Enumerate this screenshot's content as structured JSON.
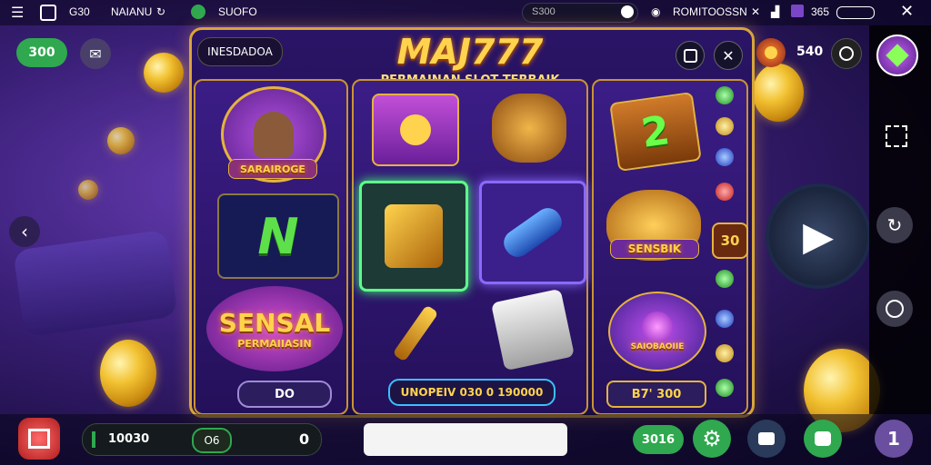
{
  "status_bar": {
    "left_code": "G30",
    "network_name": "NAIANU",
    "app_label": "SUOFO",
    "search_placeholder": "S300",
    "right_label": "ROMITOOSSN",
    "battery_text": "365"
  },
  "top_left": {
    "balance_badge": "300"
  },
  "game": {
    "tab_title": "INESDADOA",
    "logo": "MAJ777",
    "subtitle": "PERMAINAN SLOT TERBAIK",
    "top_right_value": "540",
    "left_reel_banner": "SARAIROGE",
    "left_reel_symbol": "N",
    "left_reel_logo_line1": "SENSAL",
    "left_reel_logo_line2": "PERMAIIASIN",
    "left_reel_button": "DO",
    "middle_win_text": "UNOPEIV 030 0 190000",
    "right_reel_symbol": "2",
    "right_reel_label": "SENSBIK",
    "right_reel_gem_label": "SAIOBAOIIE",
    "right_reel_side_num": "30",
    "right_reel_button": "B7' 300"
  },
  "bottom_bar": {
    "bet_value": "10030",
    "toggle_label": "O6",
    "counter": "0",
    "credit_badge": "3016"
  },
  "colors": {
    "accent_gold": "#d7a53a",
    "green": "#2fa84f",
    "purple_bg": "#3a1f77"
  },
  "icons": [
    "menu-icon",
    "gallery-icon",
    "spotify-icon",
    "nfc-icon",
    "close-icon",
    "fullscreen-icon",
    "refresh-icon",
    "circle-icon",
    "back-icon",
    "play-icon",
    "settings-icon",
    "shop-icon",
    "chat-icon",
    "notification-icon",
    "lock-icon",
    "search-icon"
  ]
}
